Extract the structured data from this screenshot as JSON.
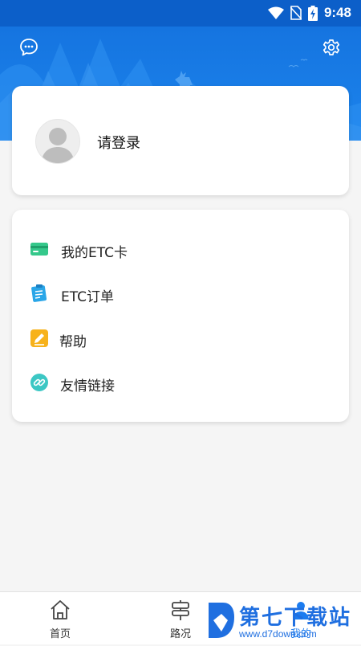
{
  "status_bar": {
    "time": "9:48"
  },
  "colors": {
    "primary": "#1c84ec",
    "header_dark": "#0c5fc9",
    "background": "#f5f5f5"
  },
  "header": {
    "left_icon": "message-icon",
    "right_icon": "gear-icon"
  },
  "login_card": {
    "text": "请登录",
    "avatar_icon": "user-icon"
  },
  "menu": {
    "items": [
      {
        "label": "我的ETC卡",
        "icon": "card-icon"
      },
      {
        "label": "ETC订单",
        "icon": "clipboard-icon"
      },
      {
        "label": "帮助",
        "icon": "pencil-icon"
      },
      {
        "label": "友情链接",
        "icon": "link-icon"
      }
    ]
  },
  "bottom_nav": {
    "items": [
      {
        "label": "首页",
        "icon": "home-icon"
      },
      {
        "label": "路况",
        "icon": "signpost-icon"
      },
      {
        "label": "我的",
        "icon": "person-icon"
      }
    ]
  },
  "watermark": {
    "name": "第七下载站",
    "url": "www.d7down.com"
  }
}
